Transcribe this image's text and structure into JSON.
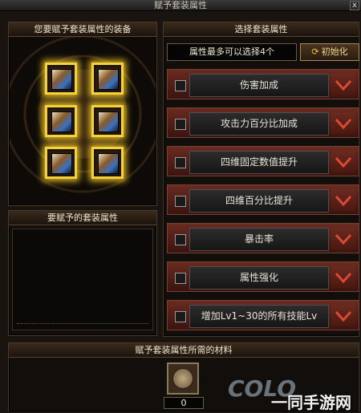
{
  "window": {
    "title": "赋予套装属性",
    "close_glyph": "x"
  },
  "equip_panel": {
    "title": "您要赋予套装属性的装备",
    "slot_count": 6
  },
  "attr_panel": {
    "title": "要赋予的套装属性"
  },
  "select_panel": {
    "title": "选择套装属性",
    "tip": "属性最多可以选择4个",
    "init_label": "初始化",
    "options": [
      {
        "label": "伤害加成"
      },
      {
        "label": "攻击力百分比加成"
      },
      {
        "label": "四维固定数值提升"
      },
      {
        "label": "四维百分比提升"
      },
      {
        "label": "暴击率"
      },
      {
        "label": "属性强化"
      },
      {
        "label": "增加Lv1~30的所有技能Lv"
      }
    ]
  },
  "material_panel": {
    "title": "赋予套装属性所需的材料",
    "count": "0"
  },
  "watermark": {
    "text": "一同手游网",
    "logo": "COLO"
  },
  "colors": {
    "accent_gold": "#f5d23a",
    "row_red": "#6a2a20",
    "chev_red": "#d84a34"
  }
}
